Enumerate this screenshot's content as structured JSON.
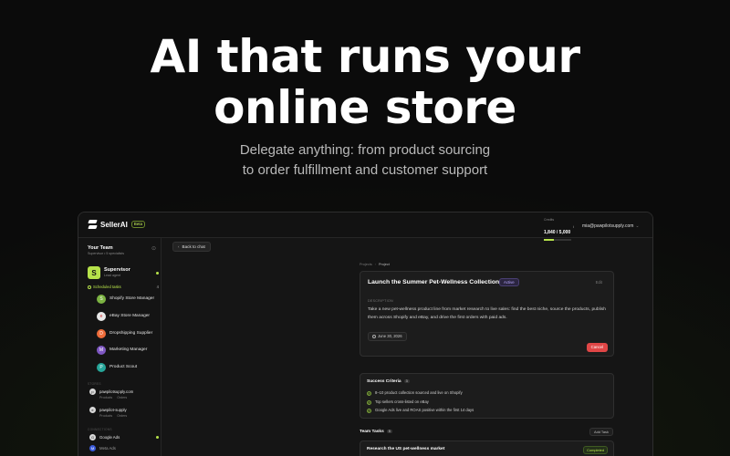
{
  "hero": {
    "title_line1": "AI that runs your",
    "title_line2": "online store",
    "subtitle_line1": "Delegate anything: from product sourcing",
    "subtitle_line2": "to order fulfillment and customer support"
  },
  "app": {
    "logo_text": "SellerAI",
    "beta_label": "Beta",
    "credits_label": "Credits",
    "credits_value": "1,840 / 5,000",
    "credits_fraction": 0.368,
    "credits_info": "i",
    "account_email": "mia@pawpilotsupply.com"
  },
  "sidebar": {
    "team_title": "Your Team",
    "team_sub": "Supervisor • 5 specialists",
    "supervisor_name": "Supervisor",
    "supervisor_role": "Lead agent",
    "supervisor_initial": "S",
    "scheduled_label": "Scheduled tasks",
    "scheduled_count": "4",
    "agents": [
      {
        "label": "Shopify Store Manager",
        "initial": "S",
        "color": "#7cb342"
      },
      {
        "label": "eBay Store Manager",
        "initial": "e",
        "color": "#e8e8e8"
      },
      {
        "label": "Dropshipping Supplier",
        "initial": "D",
        "color": "#ef6c3a"
      },
      {
        "label": "Marketing Manager",
        "initial": "M",
        "color": "#7e57c2"
      },
      {
        "label": "Product Scout",
        "initial": "P",
        "color": "#26a69a"
      }
    ],
    "stores_label": "STORES",
    "stores": [
      {
        "name": "pawpilotsupply.com",
        "initial": "p",
        "links": [
          "Products",
          "Orders"
        ]
      },
      {
        "name": "pawpilot-supply",
        "initial": "e",
        "links": [
          "Products",
          "Orders"
        ]
      }
    ],
    "connections_label": "CONNECTIONS",
    "connections": [
      {
        "name": "Google Ads",
        "initial": "G"
      },
      {
        "name": "Meta Ads",
        "initial": "M"
      }
    ]
  },
  "main": {
    "back_label": "Back to chat",
    "crumbs": [
      "Projects",
      "Project"
    ],
    "project": {
      "title": "Launch the Summer Pet-Wellness Collection",
      "status": "Active",
      "edit_label": "Edit",
      "description_label": "DESCRIPTION",
      "description": "Take a new pet-wellness product line from market research to live sales: find the best niche, source the products, publish them across Shopify and eBay, and drive the first orders with paid ads.",
      "date": "June 30, 2026",
      "cancel_label": "Cancel"
    },
    "criteria": {
      "title": "Success Criteria",
      "count": "3",
      "items": [
        "8–10 product collection sourced and live on Shopify",
        "Top sellers cross-listed on eBay",
        "Google Ads live and ROAS positive within the first 14 days"
      ]
    },
    "tasks": {
      "title": "Team Tasks",
      "count": "5",
      "add_label": "Add Task",
      "items": [
        {
          "name": "Research the US pet-wellness market",
          "status": "Completed"
        }
      ]
    }
  },
  "colors": {
    "accent": "#b6e24a",
    "danger": "#e04646",
    "active_badge": "#b8a8ff"
  }
}
